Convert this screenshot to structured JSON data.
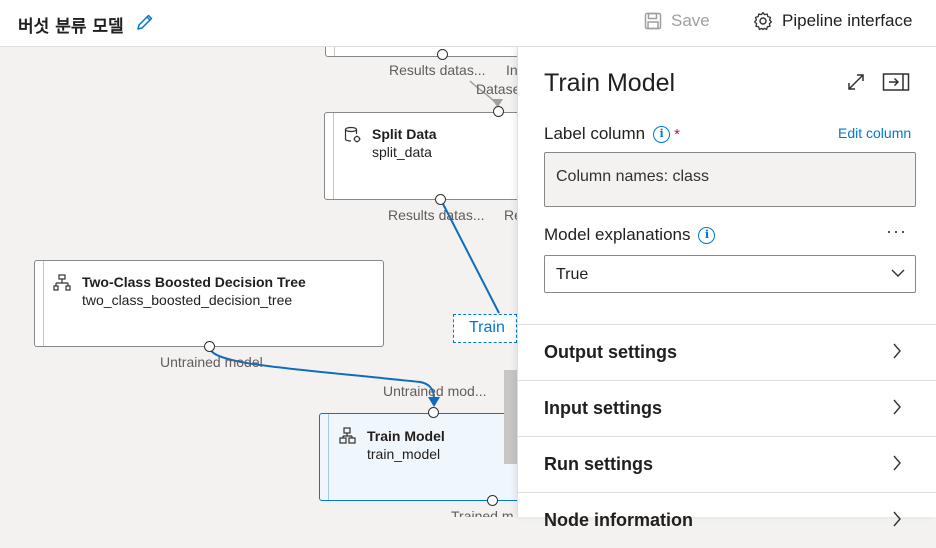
{
  "header": {
    "title": "버섯 분류 모델",
    "save_label": "Save",
    "pipeline_interface_label": "Pipeline interface"
  },
  "canvas": {
    "top_node": {
      "port_label_left": "Results datas...",
      "port_label_right": "In",
      "incoming_label": "Datase"
    },
    "split_data": {
      "title": "Split Data",
      "subtitle": "split_data",
      "port_label_left": "Results datas...",
      "port_label_right": "Re"
    },
    "boosted_tree": {
      "title": "Two-Class Boosted Decision Tree",
      "subtitle": "two_class_boosted_decision_tree",
      "port_label": "Untrained model"
    },
    "train_model": {
      "title": "Train Model",
      "subtitle": "train_model",
      "input_label": "Untrained mod...",
      "output_label": "Trained m"
    },
    "drag_label": "Train"
  },
  "panel": {
    "title": "Train Model",
    "label_column": {
      "label": "Label column",
      "required_mark": "*",
      "edit_link": "Edit column",
      "value": "Column names: class"
    },
    "model_explanations": {
      "label": "Model explanations",
      "more": "···",
      "selected": "True"
    },
    "sections": [
      {
        "label": "Output settings"
      },
      {
        "label": "Input settings"
      },
      {
        "label": "Run settings"
      },
      {
        "label": "Node information"
      }
    ]
  },
  "colors": {
    "accent": "#0078d4",
    "required": "#a4262c",
    "wire": "#0f6cbd"
  }
}
